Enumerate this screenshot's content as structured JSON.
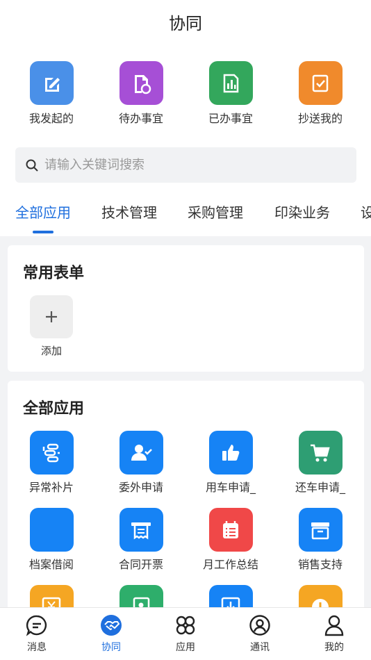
{
  "header": {
    "title": "协同"
  },
  "quick_actions": [
    {
      "label": "我发起的",
      "color": "#4a90e8",
      "icon": "edit-icon"
    },
    {
      "label": "待办事宜",
      "color": "#a64fd6",
      "icon": "pending-doc-icon"
    },
    {
      "label": "已办事宜",
      "color": "#33a75c",
      "icon": "chart-doc-icon"
    },
    {
      "label": "抄送我的",
      "color": "#f08a2c",
      "icon": "checkbox-icon"
    }
  ],
  "search": {
    "placeholder": "请输入关键词搜索"
  },
  "tabs": [
    {
      "label": "全部应用",
      "active": true
    },
    {
      "label": "技术管理"
    },
    {
      "label": "采购管理"
    },
    {
      "label": "印染业务"
    },
    {
      "label": "设"
    }
  ],
  "common_forms": {
    "title": "常用表单",
    "add_label": "添加"
  },
  "all_apps": {
    "title": "全部应用",
    "items": [
      {
        "label": "异常补片",
        "color": "#1683f5",
        "icon": "flow-icon"
      },
      {
        "label": "委外申请",
        "color": "#1683f5",
        "icon": "user-check-icon"
      },
      {
        "label": "用车申请_",
        "color": "#1683f5",
        "icon": "thumbs-up-icon"
      },
      {
        "label": "还车申请_",
        "color": "#2e9e73",
        "icon": "cart-icon"
      },
      {
        "label": "档案借阅",
        "color": "#1683f5",
        "icon": "archive-blank-icon"
      },
      {
        "label": "合同开票",
        "color": "#1683f5",
        "icon": "receipt-icon"
      },
      {
        "label": "月工作总结",
        "color": "#f04848",
        "icon": "calendar-list-icon"
      },
      {
        "label": "销售支持",
        "color": "#1683f5",
        "icon": "box-icon"
      },
      {
        "label": "",
        "color": "#f5a623",
        "icon": "yen-icon"
      },
      {
        "label": "",
        "color": "#2eae6b",
        "icon": "contact-book-icon"
      },
      {
        "label": "",
        "color": "#1683f5",
        "icon": "download-icon"
      },
      {
        "label": "",
        "color": "#f5a623",
        "icon": "alert-icon"
      }
    ]
  },
  "bottom_nav": [
    {
      "label": "消息",
      "icon": "message-icon"
    },
    {
      "label": "协同",
      "icon": "handshake-icon",
      "active": true
    },
    {
      "label": "应用",
      "icon": "apps-icon"
    },
    {
      "label": "通讯",
      "icon": "contacts-icon"
    },
    {
      "label": "我的",
      "icon": "profile-icon"
    }
  ],
  "colors": {
    "accent": "#1f6fde"
  }
}
